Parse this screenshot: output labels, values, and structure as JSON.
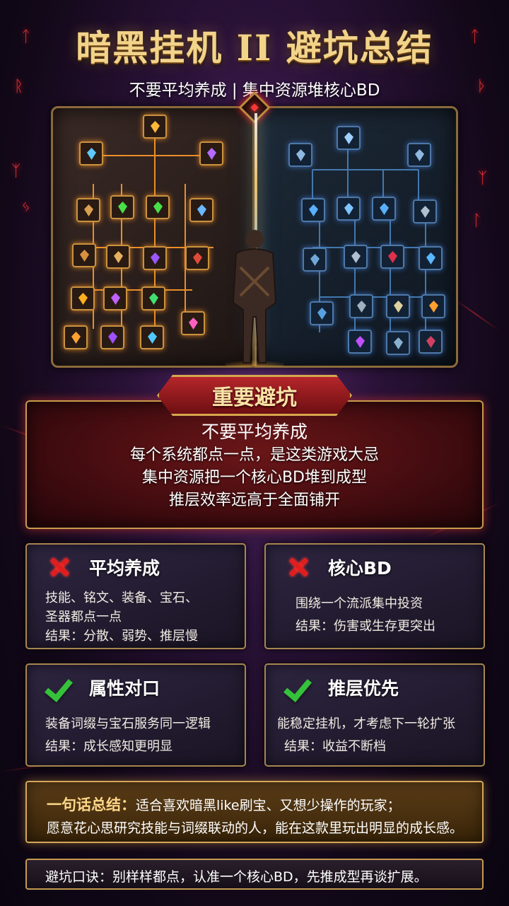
{
  "title": "暗黑挂机 II 避坑总结",
  "subtitle": "不要平均养成 | 集中资源堆核心BD",
  "banner": "重要避坑",
  "warning": {
    "heading": "不要平均养成",
    "lines": [
      "每个系统都点一点，是这类游戏大忌",
      "集中资源把一个核心BD堆到成型",
      "推层效率远高于全面铺开"
    ]
  },
  "cards": [
    {
      "icon": "x-mark-icon",
      "title": "平均养成",
      "lines": [
        "技能、铭文、装备、宝石、",
        "圣器都点一点",
        "结果：分散、弱势、推层慢"
      ]
    },
    {
      "icon": "x-mark-icon",
      "title": "核心BD",
      "lines": [
        "围绕一个流派集中投资",
        "结果：伤害或生存更突出"
      ]
    },
    {
      "icon": "check-mark-icon",
      "title": "属性对口",
      "lines": [
        "装备词缀与宝石服务同一逻辑",
        "结果：成长感知更明显"
      ]
    },
    {
      "icon": "check-mark-icon",
      "title": "推层优先",
      "lines": [
        "能稳定挂机，才考虑下一轮扩张",
        "结果：收益不断档"
      ]
    }
  ],
  "summary": {
    "label": "一句话总结：",
    "line1": "适合喜欢暗黑like刷宝、又想少操作的玩家；",
    "line2": "愿意花心思研究技能与词缀联动的人，能在这款里玩出明显的成长感。"
  },
  "motto": "避坑口诀：别样样都点，认准一个核心BD，先推成型再谈扩展。",
  "colors": {
    "accent_gold": "#d4a757",
    "warn_red": "#b5262a",
    "cross_red": "#e01e1e",
    "check_green": "#35c23a"
  }
}
